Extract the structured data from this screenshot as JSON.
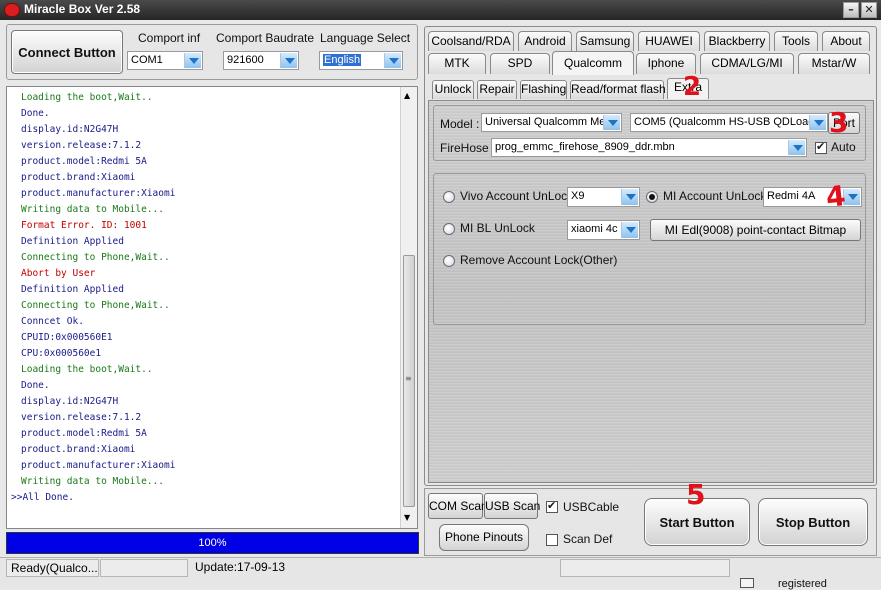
{
  "window": {
    "title": "Miracle Box Ver 2.58",
    "minimize_glyph": "–",
    "close_glyph": "✕"
  },
  "connection": {
    "connect_button": "Connect Button",
    "comport_label": "Comport inf",
    "comport_value": "COM1",
    "baud_label": "Comport Baudrate",
    "baud_value": "921600",
    "language_label": "Language Select",
    "language_value": "English"
  },
  "log": [
    {
      "text": "Loading the boot,Wait..",
      "color": "#1a7a1a"
    },
    {
      "text": "Done.",
      "color": "#1a1a8a"
    },
    {
      "text": "display.id:N2G47H",
      "color": "#1a1a8a"
    },
    {
      "text": "version.release:7.1.2",
      "color": "#1a1a8a"
    },
    {
      "text": "product.model:Redmi 5A",
      "color": "#1a1a8a"
    },
    {
      "text": "product.brand:Xiaomi",
      "color": "#1a1a8a"
    },
    {
      "text": "product.manufacturer:Xiaomi",
      "color": "#1a1a8a"
    },
    {
      "text": "Writing data to Mobile...",
      "color": "#1a7a1a"
    },
    {
      "text": "Format Error. ID: 1001",
      "color": "#c00000"
    },
    {
      "text": "Definition Applied",
      "color": "#1a1a8a"
    },
    {
      "text": "Connecting to Phone,Wait..",
      "color": "#1a7a1a"
    },
    {
      "text": "Abort by User",
      "color": "#c00000"
    },
    {
      "text": "Definition Applied",
      "color": "#1a1a8a"
    },
    {
      "text": "Connecting to Phone,Wait..",
      "color": "#1a7a1a"
    },
    {
      "text": "Conncet Ok.",
      "color": "#1a1a8a"
    },
    {
      "text": "CPUID:0x000560E1",
      "color": "#1a1a8a"
    },
    {
      "text": "CPU:0x000560e1",
      "color": "#1a1a8a"
    },
    {
      "text": "Loading the boot,Wait..",
      "color": "#1a7a1a"
    },
    {
      "text": "Done.",
      "color": "#1a1a8a"
    },
    {
      "text": "display.id:N2G47H",
      "color": "#1a1a8a"
    },
    {
      "text": "version.release:7.1.2",
      "color": "#1a1a8a"
    },
    {
      "text": "product.model:Redmi 5A",
      "color": "#1a1a8a"
    },
    {
      "text": "product.brand:Xiaomi",
      "color": "#1a1a8a"
    },
    {
      "text": "product.manufacturer:Xiaomi",
      "color": "#1a1a8a"
    },
    {
      "text": "Writing data to Mobile...",
      "color": "#1a7a1a"
    },
    {
      "text": ">>All Done.",
      "color": "#1a1a8a"
    }
  ],
  "progress": {
    "label": "100%",
    "fraction": 1.0,
    "color": "#0000e6"
  },
  "tabs_row1": [
    "Coolsand/RDA",
    "Android",
    "Samsung",
    "HUAWEI",
    "Blackberry",
    "Tools",
    "About"
  ],
  "tabs_row2": [
    "MTK",
    "SPD",
    "Qualcomm",
    "Iphone",
    "CDMA/LG/MI",
    "Mstar/W"
  ],
  "active_tab": "Qualcomm",
  "subtabs": [
    "Unlock",
    "Repair",
    "Flashing",
    "Read/format flash",
    "Extra"
  ],
  "active_subtab": "Extra",
  "qualcomm": {
    "model_label": "Model :",
    "model_value": "Universal Qualcomm Mel",
    "port_value": "COM5 (Qualcomm HS-USB QDLoad",
    "port_button": "Port",
    "firehose_label": "FireHose :",
    "firehose_value": "prog_emmc_firehose_8909_ddr.mbn",
    "auto_label": "Auto",
    "auto_checked": true
  },
  "extra": {
    "vivo_label": "Vivo Account UnLock",
    "vivo_value": "X9",
    "mi_account_label": "MI Account UnLock",
    "mi_account_value": "Redmi 4A",
    "mi_account_selected": true,
    "mi_bl_label": "MI BL UnLock",
    "mi_bl_value": "xiaomi 4c",
    "mi_edl_button": "MI Edl(9008) point-contact Bitmap",
    "remove_label": "Remove Account Lock(Other)"
  },
  "bottom": {
    "com_scan": "COM Scan",
    "usb_scan": "USB Scan",
    "usbcable_label": "USBCable",
    "usbcable_checked": true,
    "phone_pinouts": "Phone Pinouts",
    "scan_def_label": "Scan Def",
    "scan_def_checked": false,
    "start_button": "Start Button",
    "stop_button": "Stop Button"
  },
  "statusbar": {
    "status": "Ready(Qualco...",
    "update": "Update:17-09-13",
    "registered": "registered"
  },
  "annotations": [
    "1",
    "2",
    "3",
    "4",
    "5"
  ],
  "annotation_color": "#e0111b"
}
